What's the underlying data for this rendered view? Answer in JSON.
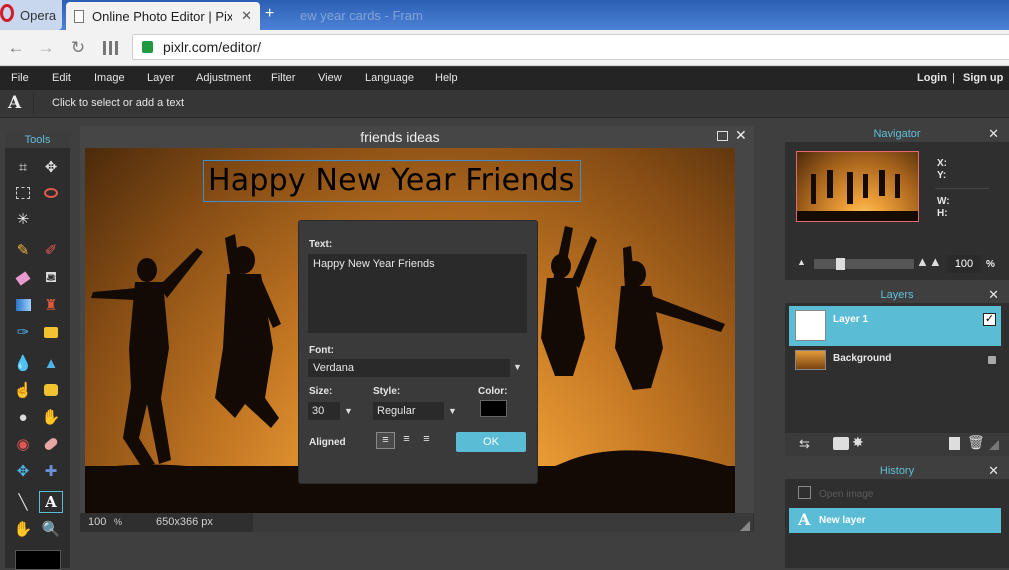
{
  "browser": {
    "tabs": [
      {
        "label": "Opera"
      },
      {
        "label": "Online Photo Editor | Pixlr"
      },
      {
        "label": "ew year cards - Fram"
      }
    ],
    "url": "pixlr.com/editor/"
  },
  "menu": {
    "items": [
      "File",
      "Edit",
      "Image",
      "Layer",
      "Adjustment",
      "Filter",
      "View",
      "Language",
      "Help"
    ],
    "login": "Login",
    "separator": "|",
    "signup": "Sign up"
  },
  "options": {
    "hint": "Click to select or add a text"
  },
  "tools": {
    "header": "Tools"
  },
  "canvas": {
    "title": "friends ideas",
    "text_layer": "Happy New Year Friends",
    "zoom": "100",
    "zoom_unit": "%",
    "dimensions": "650x366 px"
  },
  "text_dialog": {
    "text_label": "Text:",
    "text_value": "Happy New Year Friends",
    "font_label": "Font:",
    "font_value": "Verdana",
    "size_label": "Size:",
    "size_value": "30",
    "style_label": "Style:",
    "style_value": "Regular",
    "color_label": "Color:",
    "color_value": "#000000",
    "aligned_label": "Aligned",
    "ok_label": "OK"
  },
  "navigator": {
    "title": "Navigator",
    "x_label": "X:",
    "y_label": "Y:",
    "w_label": "W:",
    "h_label": "H:",
    "zoom_value": "100",
    "zoom_unit": "%"
  },
  "layers": {
    "title": "Layers",
    "items": [
      {
        "name": "Layer 1",
        "selected": true
      },
      {
        "name": "Background",
        "locked": true
      }
    ]
  },
  "history": {
    "title": "History",
    "items": [
      {
        "label": "Open image"
      },
      {
        "label": "New layer",
        "selected": true
      }
    ]
  },
  "colors": {
    "accent": "#5bbcd6",
    "menubar": "#242424",
    "panel": "#2f2f2f"
  }
}
